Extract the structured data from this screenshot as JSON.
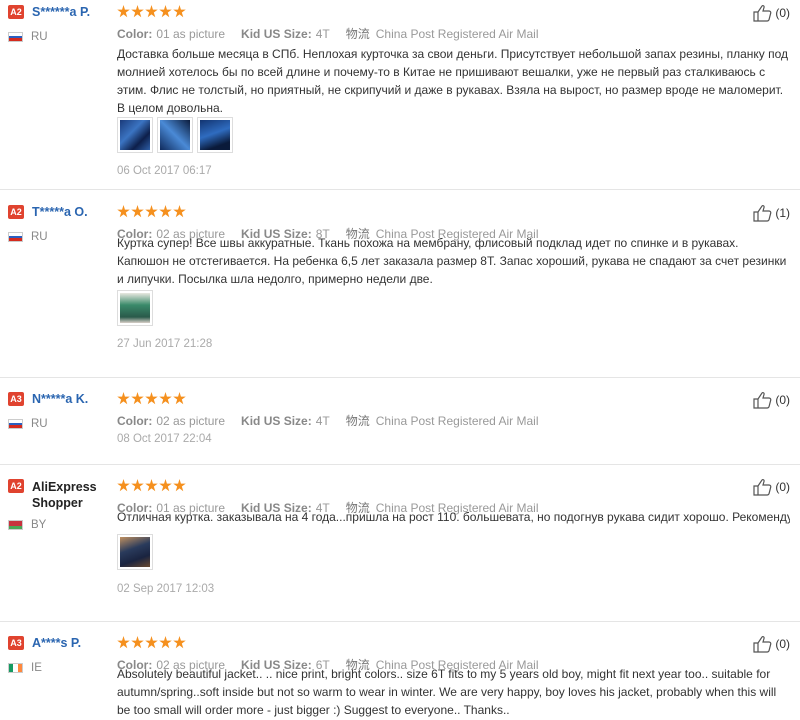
{
  "reviews": [
    {
      "badge": "A2",
      "name": "S******a P.",
      "country": "RU",
      "meta": {
        "color_label": "Color:",
        "color_value": "01 as picture",
        "size_label": "Kid US Size:",
        "size_value": "4T",
        "ship_icon": "物流",
        "ship_value": "China Post Registered Air Mail"
      },
      "text": "Доставка больше месяца в СПб. Неплохая курточка за свои деньги. Присутствует небольшой запах резины, планку под молнией хотелось бы по всей длине и почему-то в Китае не пришивают вешалки, уже не первый раз сталкиваюсь с этим. Флис не толстый, но приятный, не скрипучий и даже в рукавах. Взяла на вырост, но размер вроде не маломерит. В целом довольна.",
      "date": "06 Oct 2017 06:17",
      "helpful": "(0)"
    },
    {
      "badge": "A2",
      "name": "T*****a O.",
      "country": "RU",
      "meta": {
        "color_label": "Color:",
        "color_value": "02 as picture",
        "size_label": "Kid US Size:",
        "size_value": "8T",
        "ship_icon": "物流",
        "ship_value": "China Post Registered Air Mail"
      },
      "text": "Куртка супер! Все швы аккуратные. Ткань похожа на мембрану, флисовый подклад идет по спинке и в рукавах. Капюшон не отстегивается. На ребенка 6,5 лет заказала размер 8Т. Запас хороший, рукава не спадают за счет резинки и липучки. Посылка шла недолго, примерно недели две.",
      "date": "27 Jun 2017 21:28",
      "helpful": "(1)"
    },
    {
      "badge": "A3",
      "name": "N*****a K.",
      "country": "RU",
      "meta": {
        "color_label": "Color:",
        "color_value": "02 as picture",
        "size_label": "Kid US Size:",
        "size_value": "4T",
        "ship_icon": "物流",
        "ship_value": "China Post Registered Air Mail"
      },
      "text": "",
      "date": "08 Oct 2017 22:04",
      "helpful": "(0)"
    },
    {
      "badge": "A2",
      "name": "AliExpress Shopper",
      "country": "BY",
      "meta": {
        "color_label": "Color:",
        "color_value": "01 as picture",
        "size_label": "Kid US Size:",
        "size_value": "4T",
        "ship_icon": "物流",
        "ship_value": "China Post Registered Air Mail"
      },
      "text": "Отличная куртка. заказывала на 4 года...пришла на рост 110. большевата, но подогнув рукава сидит хорошо. Рекомендую",
      "date": "02 Sep 2017 12:03",
      "helpful": "(0)"
    },
    {
      "badge": "A3",
      "name": "A****s P.",
      "country": "IE",
      "meta": {
        "color_label": "Color:",
        "color_value": "02 as picture",
        "size_label": "Kid US Size:",
        "size_value": "6T",
        "ship_icon": "物流",
        "ship_value": "China Post Registered Air Mail"
      },
      "text": "Absolutely beautiful jacket.. .. nice print, bright colors.. size 6T fits to my 5 years old boy, might fit next year too.. suitable for autumn/spring..soft inside but not so warm to wear in winter. We are very happy, boy loves his jacket, probably when this will be too small will order more - just bigger :) Suggest to everyone.. Thanks..",
      "date": "",
      "helpful": "(0)"
    }
  ],
  "colors": {
    "badge": "#e0432f",
    "star": "#f5901e",
    "name": "#2a65b0"
  },
  "icons": {
    "helpful": "thumbs-up-icon",
    "rating": "star-icon"
  }
}
